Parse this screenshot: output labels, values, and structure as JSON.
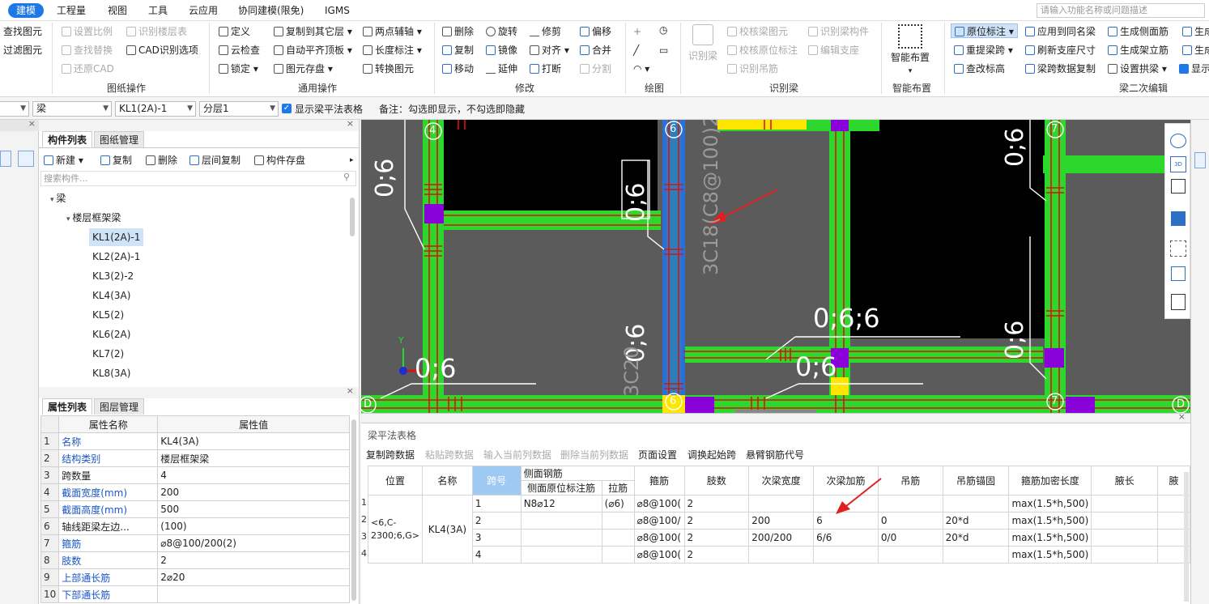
{
  "menu": {
    "items": [
      "建模",
      "工程量",
      "视图",
      "工具",
      "云应用",
      "协同建模(限免)",
      "IGMS"
    ],
    "active": "建模",
    "search_placeholder": "请输入功能名称或问题描述"
  },
  "ribbon": {
    "find": {
      "find_label": "查找图元",
      "filter_label": "过滤图元"
    },
    "drawing_ops": {
      "set_scale": "设置比例",
      "find_replace": "查找替换",
      "restore_cad": "还原CAD",
      "recognize_floor": "识别楼层表",
      "cad_options": "CAD识别选项",
      "group": "图纸操作"
    },
    "common_ops": {
      "define": "定义",
      "cloud_check": "云检查",
      "lock": "锁定",
      "copy_to_floor": "复制到其它层",
      "auto_flush": "自动平齐顶板",
      "element_save": "图元存盘",
      "two_point_axis": "两点辅轴",
      "length_label": "长度标注",
      "convert_element": "转换图元",
      "group": "通用操作"
    },
    "modify": {
      "delete": "删除",
      "copy": "复制",
      "move": "移动",
      "rotate": "旋转",
      "mirror": "镜像",
      "extend": "延伸",
      "trim": "修剪",
      "align": "对齐",
      "break": "打断",
      "offset": "偏移",
      "merge": "合并",
      "split": "分割",
      "group": "修改"
    },
    "draw": {
      "group": "绘图"
    },
    "recognize_beam": {
      "big": "识别梁",
      "check_beam": "校核梁图元",
      "check_support": "校核原位标注",
      "recognize_hanger": "识别吊筋",
      "recognize_component": "识别梁构件",
      "edit_support": "编辑支座",
      "group": "识别梁"
    },
    "smart": {
      "big": "智能布置",
      "group": "智能布置"
    },
    "beam_edit": {
      "in_situ": "原位标注",
      "re_span": "重提梁跨",
      "check_elev": "查改标高",
      "apply_same": "应用到同名梁",
      "refresh_support": "刷新支座尺寸",
      "copy_span": "梁跨数据复制",
      "gen_side": "生成侧面筋",
      "gen_stirrup": "生成架立筋",
      "set_arch": "设置拱梁",
      "gen_more": "生成",
      "gen_more2": "生成支座",
      "show": "显示",
      "group": "梁二次编辑"
    }
  },
  "toolbar2": {
    "element_type": "梁",
    "component": "KL1(2A)-1",
    "layer": "分层1",
    "show_table_label": "显示梁平法表格",
    "note": "备注：勾选即显示，不勾选即隐藏"
  },
  "component_panel": {
    "tabs": [
      "构件列表",
      "图纸管理"
    ],
    "actions": {
      "new": "新建",
      "copy": "复制",
      "delete": "删除",
      "floor_copy": "层间复制",
      "save": "构件存盘"
    },
    "search_placeholder": "搜索构件...",
    "tree_root": "梁",
    "tree_group": "楼层框架梁",
    "items": [
      "KL1(2A)-1",
      "KL2(2A)-1",
      "KL3(2)-2",
      "KL4(3A)",
      "KL5(2)",
      "KL6(2A)",
      "KL7(2)",
      "KL8(3A)"
    ],
    "selected": "KL1(2A)-1"
  },
  "property_panel": {
    "tabs": [
      "属性列表",
      "图层管理"
    ],
    "col_name": "属性名称",
    "col_value": "属性值",
    "rows": [
      {
        "n": "1",
        "name": "名称",
        "value": "KL4(3A)",
        "blue": true
      },
      {
        "n": "2",
        "name": "结构类别",
        "value": "楼层框架梁",
        "blue": true
      },
      {
        "n": "3",
        "name": "跨数量",
        "value": "4",
        "blue": false
      },
      {
        "n": "4",
        "name": "截面宽度(mm)",
        "value": "200",
        "blue": true
      },
      {
        "n": "5",
        "name": "截面高度(mm)",
        "value": "500",
        "blue": true
      },
      {
        "n": "6",
        "name": "轴线距梁左边...",
        "value": "(100)",
        "blue": false
      },
      {
        "n": "7",
        "name": "箍筋",
        "value": "⌀8@100/200(2)",
        "blue": true
      },
      {
        "n": "8",
        "name": "肢数",
        "value": "2",
        "blue": true
      },
      {
        "n": "9",
        "name": "上部通长筋",
        "value": "2⌀20",
        "blue": true
      },
      {
        "n": "10",
        "name": "下部通长筋",
        "value": "",
        "blue": true
      }
    ]
  },
  "canvas": {
    "axis_labels": [
      "4",
      "6",
      "7",
      "D",
      "6",
      "7",
      "D"
    ],
    "annotations": [
      "0;6",
      "0;6",
      "0;6",
      "0;6;6",
      "0;6",
      "0;6",
      "0;6",
      "0;6"
    ],
    "vertical_text_1": "3C18(C8@100)2",
    "vertical_text_2": "3C20",
    "axis_y": "Y"
  },
  "beam_table": {
    "title": "梁平法表格",
    "actions": [
      "复制跨数据",
      "粘贴跨数据",
      "输入当前列数据",
      "删除当前列数据",
      "页面设置",
      "调换起始跨",
      "悬臂钢筋代号"
    ],
    "headers": {
      "position": "位置",
      "name": "名称",
      "span": "跨号",
      "side_bars": "侧面钢筋",
      "side_in_situ": "侧面原位标注筋",
      "tie_bar": "拉筋",
      "stirrup": "箍筋",
      "legs": "肢数",
      "sec_width": "次梁宽度",
      "sec_add": "次梁加筋",
      "hanger": "吊筋",
      "hanger_anchor": "吊筋锚固",
      "dense_len": "箍筋加密长度",
      "haunch_len": "腋长",
      "haunch": "腋"
    },
    "position_value": "<6,C-2300;6,G>",
    "name_value": "KL4(3A)",
    "rows": [
      {
        "rn": "1",
        "span": "1",
        "side": "N8⌀12",
        "tie": "(⌀6)",
        "stirrup": "⌀8@100(",
        "legs": "2",
        "sec_w": "",
        "sec_add": "",
        "hanger": "",
        "anchor": "",
        "dense": "max(1.5*h,500)"
      },
      {
        "rn": "2",
        "span": "2",
        "side": "",
        "tie": "",
        "stirrup": "⌀8@100/",
        "legs": "2",
        "sec_w": "200",
        "sec_add": "6",
        "hanger": "0",
        "anchor": "20*d",
        "dense": "max(1.5*h,500)"
      },
      {
        "rn": "3",
        "span": "3",
        "side": "",
        "tie": "",
        "stirrup": "⌀8@100(",
        "legs": "2",
        "sec_w": "200/200",
        "sec_add": "6/6",
        "hanger": "0/0",
        "anchor": "20*d",
        "dense": "max(1.5*h,500)"
      },
      {
        "rn": "4",
        "span": "4",
        "side": "",
        "tie": "",
        "stirrup": "⌀8@100(",
        "legs": "2",
        "sec_w": "",
        "sec_add": "",
        "hanger": "",
        "anchor": "",
        "dense": "max(1.5*h,500)"
      }
    ]
  },
  "colors": {
    "accent": "#1e78e6",
    "beam_green": "#2bd82b",
    "beam_blue": "#2a6fd8",
    "rebar_red": "#e01010",
    "arrow_red": "#e02020",
    "purple": "#8a00d8",
    "yellow": "#ffe600"
  }
}
